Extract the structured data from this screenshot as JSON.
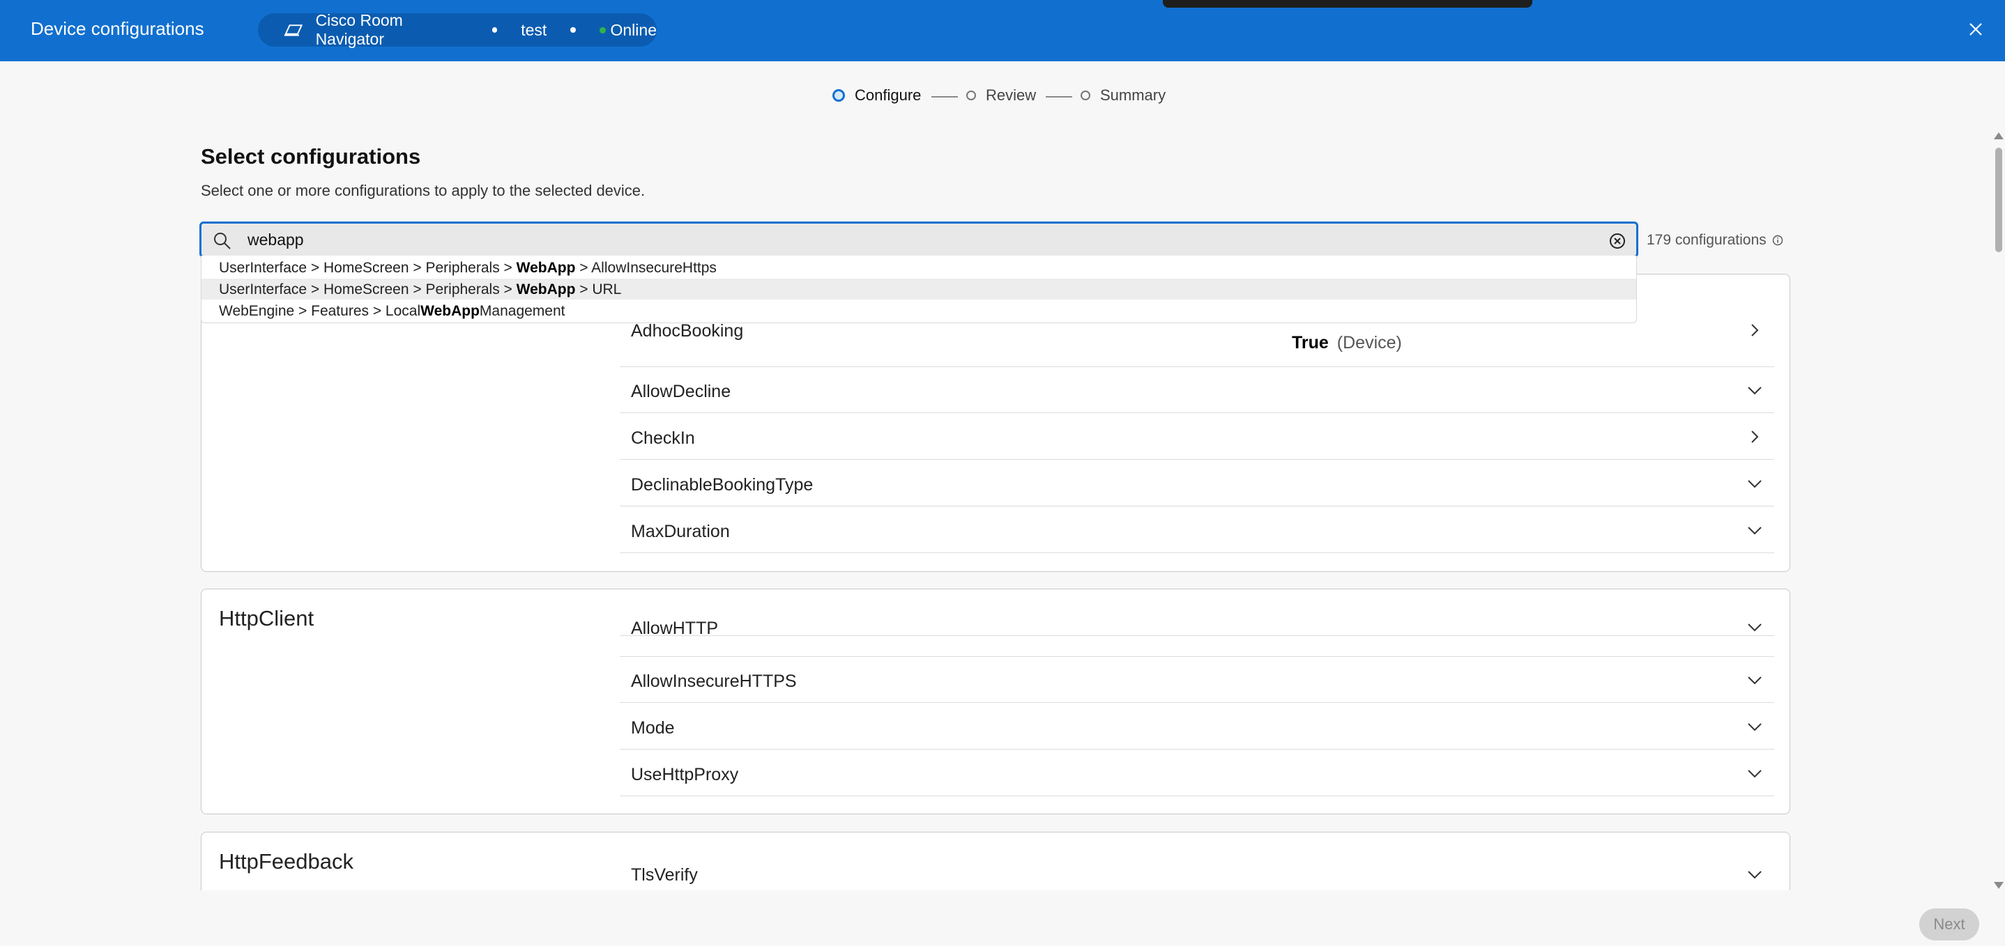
{
  "header": {
    "title": "Device configurations",
    "device_name": "Cisco Room Navigator",
    "device_tag": "test",
    "status": "Online"
  },
  "stepper": {
    "steps": [
      "Configure",
      "Review",
      "Summary"
    ],
    "active": "Configure"
  },
  "page": {
    "heading": "Select configurations",
    "subtext": "Select one or more configurations to apply to the selected device."
  },
  "search": {
    "value": "webapp",
    "count_label": "179 configurations",
    "suggestions": [
      {
        "pre": "UserInterface > HomeScreen > Peripherals > ",
        "match": "WebApp",
        "post": " > AllowInsecureHttps"
      },
      {
        "pre": "UserInterface > HomeScreen > Peripherals > ",
        "match": "WebApp",
        "post": " > URL"
      },
      {
        "pre": "WebEngine > Features > Local",
        "match": "WebApp",
        "post": "Management"
      }
    ]
  },
  "groups": [
    {
      "name": "",
      "items": [
        {
          "label": "AdhocBooking",
          "value": "True",
          "source": "(Device)",
          "icon": "chevron-right-icon"
        },
        {
          "label": "AllowDecline",
          "icon": "chevron-down-icon"
        },
        {
          "label": "CheckIn",
          "icon": "chevron-right-icon"
        },
        {
          "label": "DeclinableBookingType",
          "icon": "chevron-down-icon"
        },
        {
          "label": "MaxDuration",
          "icon": "chevron-down-icon"
        }
      ]
    },
    {
      "name": "HttpClient",
      "items": [
        {
          "label": "AllowHTTP",
          "icon": "chevron-down-icon"
        },
        {
          "label": "AllowInsecureHTTPS",
          "icon": "chevron-down-icon"
        },
        {
          "label": "Mode",
          "icon": "chevron-down-icon"
        },
        {
          "label": "UseHttpProxy",
          "icon": "chevron-down-icon"
        }
      ]
    },
    {
      "name": "HttpFeedback",
      "items": [
        {
          "label": "TlsVerify",
          "icon": "chevron-down-icon"
        }
      ]
    }
  ],
  "footer": {
    "next_label": "Next"
  },
  "colors": {
    "brand_blue": "#1170cf",
    "online_green": "#2fb34a",
    "disabled_button": "#d2d2d2"
  }
}
